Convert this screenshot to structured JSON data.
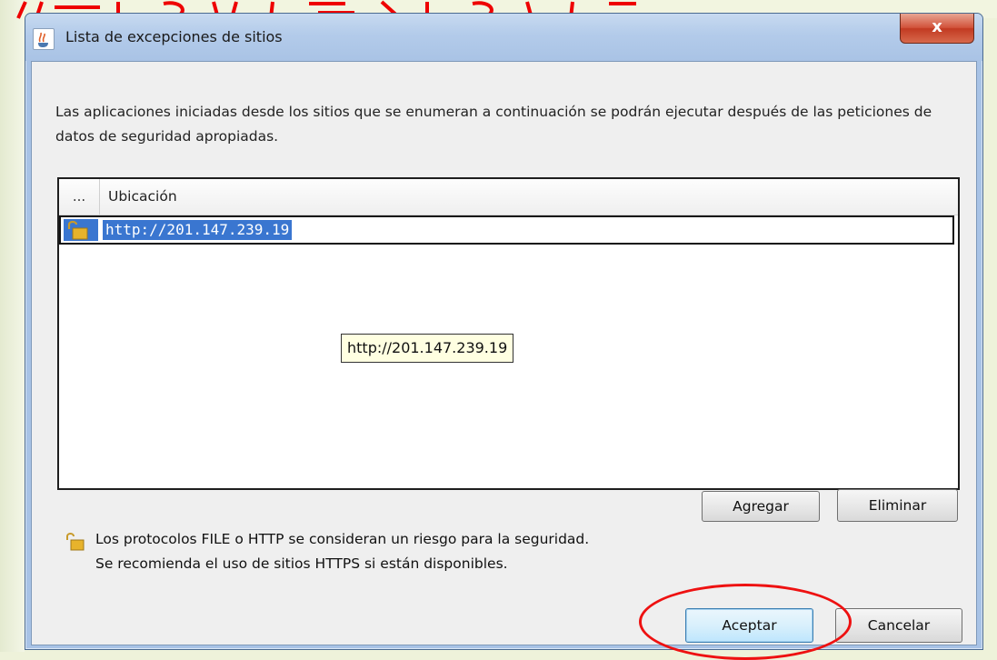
{
  "window": {
    "title": "Lista de excepciones de sitios",
    "close_glyph": "x"
  },
  "description": "Las aplicaciones iniciadas desde los sitios que se enumeran a continuación se podrán ejecutar después de las peticiones de datos de seguridad apropiadas.",
  "table": {
    "columns": [
      "...",
      "Ubicación"
    ],
    "rows": [
      {
        "icon": "open-lock-icon",
        "url": "http://201.147.239.19"
      }
    ]
  },
  "tooltip": "http://201.147.239.19",
  "buttons": {
    "agregar": "Agregar",
    "eliminar": "Eliminar",
    "aceptar": "Aceptar",
    "cancelar": "Cancelar"
  },
  "warning": {
    "icon": "open-lock-icon",
    "line1": "Los protocolos FILE o HTTP se consideran un riesgo para la seguridad.",
    "line2": "Se recomienda el uso de sitios HTTPS si están disponibles."
  },
  "colors": {
    "selection": "#3a76d0",
    "annotation": "#ee1111",
    "tooltip_bg": "#ffffe1"
  }
}
